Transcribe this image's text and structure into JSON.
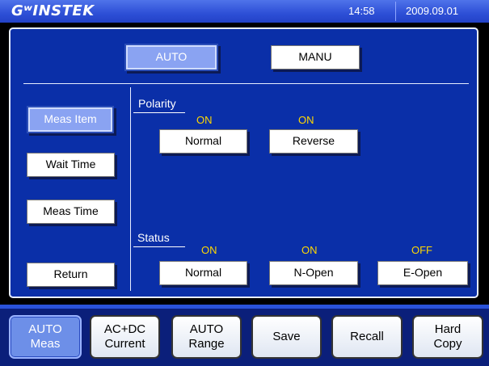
{
  "header": {
    "logo": "GʷINSTEK",
    "time": "14:58",
    "date": "2009.09.01"
  },
  "mode": {
    "auto_label": "AUTO",
    "manu_label": "MANU"
  },
  "sidebar": {
    "items": [
      {
        "label": "Meas Item"
      },
      {
        "label": "Wait Time"
      },
      {
        "label": "Meas Time"
      },
      {
        "label": "Return"
      }
    ]
  },
  "polarity": {
    "title": "Polarity",
    "options": [
      {
        "state": "ON",
        "label": "Normal"
      },
      {
        "state": "ON",
        "label": "Reverse"
      }
    ]
  },
  "status": {
    "title": "Status",
    "options": [
      {
        "state": "ON",
        "label": "Normal"
      },
      {
        "state": "ON",
        "label": "N-Open"
      },
      {
        "state": "OFF",
        "label": "E-Open"
      }
    ]
  },
  "softkeys": [
    {
      "label": "AUTO\nMeas"
    },
    {
      "label": "AC+DC\nCurrent"
    },
    {
      "label": "AUTO\nRange"
    },
    {
      "label": "Save"
    },
    {
      "label": "Recall"
    },
    {
      "label": "Hard\nCopy"
    }
  ],
  "colors": {
    "panel": "#0a2fa8",
    "state_text": "#ffd800",
    "selected": "#8aa3f2",
    "topbar": "#2d4fd6"
  }
}
